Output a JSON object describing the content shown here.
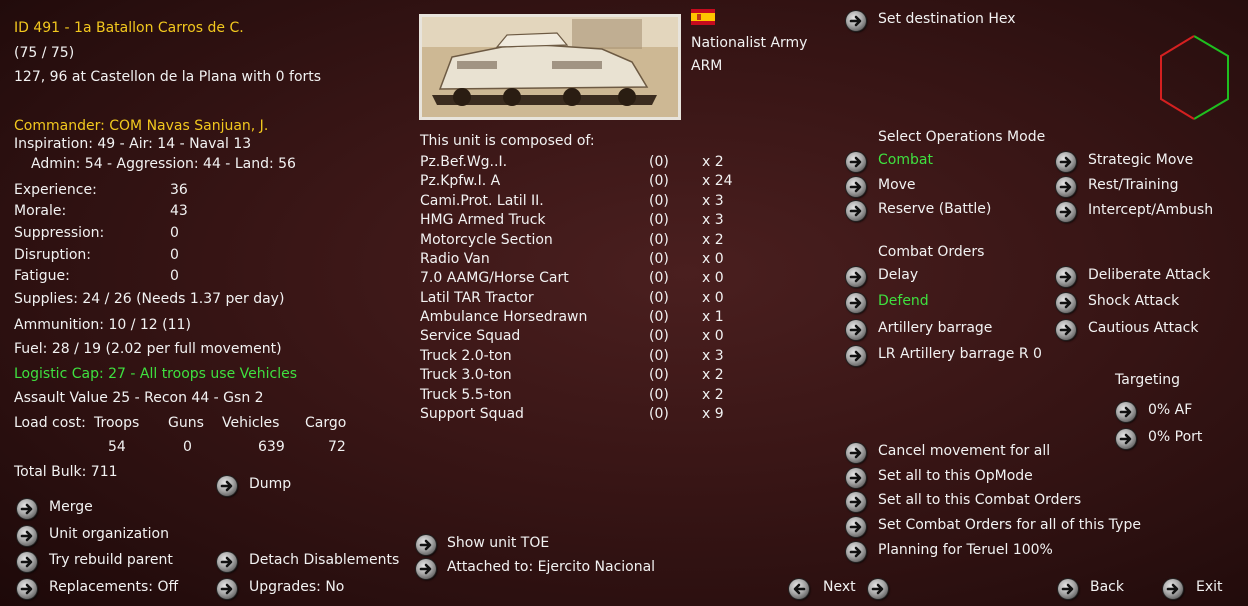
{
  "unit": {
    "header": "ID 491 - 1a  Batallon Carros de C.",
    "strength": "(75 / 75)",
    "location": "127, 96 at Castellon de la Plana with 0 forts",
    "commander": "Commander: COM Navas Sanjuan, J.",
    "inspiration": "Inspiration: 49 - Air: 14 - Naval 13",
    "admin": "Admin: 54 - Aggression: 44 - Land: 56",
    "stats": [
      {
        "label": "Experience:",
        "value": "36"
      },
      {
        "label": "Morale:",
        "value": "43"
      },
      {
        "label": "Suppression:",
        "value": "0"
      },
      {
        "label": "Disruption:",
        "value": "0"
      },
      {
        "label": "Fatigue:",
        "value": "0"
      }
    ],
    "supplies": "Supplies: 24 / 26 (Needs 1.37 per day)",
    "ammunition": "Ammunition: 10 / 12 (11)",
    "fuel": "Fuel: 28 / 19 (2.02 per full movement)",
    "logistic": "Logistic Cap: 27 - All troops use Vehicles",
    "assault": "Assault Value 25 - Recon 44 - Gsn 2",
    "load": {
      "label": "Load cost:",
      "headers": [
        "Troops",
        "Guns",
        "Vehicles",
        "Cargo"
      ],
      "values": [
        "54",
        "0",
        "639",
        "72"
      ]
    },
    "total_bulk": "Total Bulk: 711",
    "army": "Nationalist Army",
    "type": "ARM",
    "composed_title": "This unit is composed of:"
  },
  "composition": [
    {
      "name": "Pz.Bef.Wg..I.",
      "zero": "(0)",
      "qty": "x 2"
    },
    {
      "name": "Pz.Kpfw.I. A",
      "zero": "(0)",
      "qty": "x 24"
    },
    {
      "name": "Cami.Prot. Latil II.",
      "zero": "(0)",
      "qty": "x 3"
    },
    {
      "name": "HMG Armed Truck",
      "zero": "(0)",
      "qty": "x 3"
    },
    {
      "name": "Motorcycle Section",
      "zero": "(0)",
      "qty": "x 2"
    },
    {
      "name": "Radio Van",
      "zero": "(0)",
      "qty": "x 0"
    },
    {
      "name": "7.0 AAMG/Horse Cart",
      "zero": "(0)",
      "qty": "x 0"
    },
    {
      "name": "Latil TAR Tractor",
      "zero": "(0)",
      "qty": "x 0"
    },
    {
      "name": "Ambulance Horsedrawn",
      "zero": "(0)",
      "qty": "x 1"
    },
    {
      "name": "Service Squad",
      "zero": "(0)",
      "qty": "x 0"
    },
    {
      "name": "Truck 2.0-ton",
      "zero": "(0)",
      "qty": "x 3"
    },
    {
      "name": "Truck 3.0-ton",
      "zero": "(0)",
      "qty": "x 2"
    },
    {
      "name": "Truck 5.5-ton",
      "zero": "(0)",
      "qty": "x 2"
    },
    {
      "name": "Support Squad",
      "zero": "(0)",
      "qty": "x 9"
    }
  ],
  "left_buttons": {
    "dump": "Dump",
    "merge": "Merge",
    "unit_org": "Unit organization",
    "try_rebuild": "Try rebuild parent",
    "detach": "Detach Disablements",
    "replacements": "Replacements: Off",
    "upgrades": "Upgrades: No"
  },
  "middle_buttons": {
    "show_toe": "Show unit TOE",
    "attached": "Attached to: Ejercito Nacional"
  },
  "right": {
    "set_destination": "Set destination Hex",
    "ops_title": "Select Operations Mode",
    "ops": {
      "combat": "Combat",
      "strategic": "Strategic Move",
      "move": "Move",
      "rest": "Rest/Training",
      "reserve": "Reserve (Battle)",
      "intercept": "Intercept/Ambush"
    },
    "orders_title": "Combat Orders",
    "orders": {
      "delay": "Delay",
      "deliberate": "Deliberate Attack",
      "defend": "Defend",
      "shock": "Shock Attack",
      "artillery": "Artillery barrage",
      "cautious": "Cautious Attack",
      "lr_artillery": "LR Artillery barrage R 0"
    },
    "targeting_title": "Targeting",
    "targeting_af": "0% AF",
    "targeting_port": "0% Port",
    "cancel_movement": "Cancel movement for all",
    "set_opmode": "Set all to this OpMode",
    "set_orders": "Set all to this Combat Orders",
    "set_orders_type": "Set Combat Orders for all of this Type",
    "planning": "Planning for Teruel 100%"
  },
  "bottom": {
    "next": "Next",
    "back": "Back",
    "exit": "Exit"
  },
  "colors": {
    "highlight_yellow": "#f2c81e",
    "selected_green": "#3fe03f",
    "background": "#3a1616"
  }
}
